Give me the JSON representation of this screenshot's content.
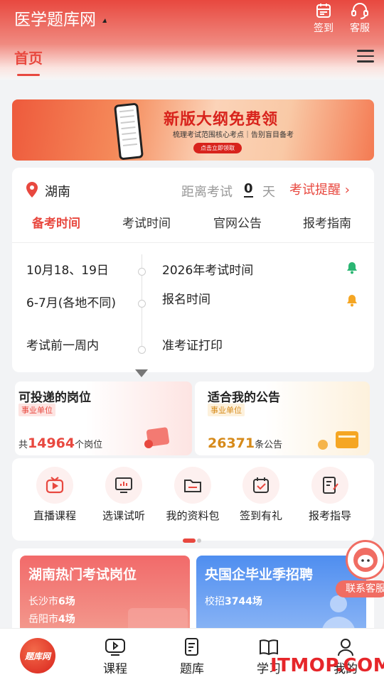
{
  "header": {
    "app_title": "医学题库网",
    "sign_label": "签到",
    "service_label": "客服",
    "home_tab": "首页"
  },
  "banner": {
    "title": "新版大纲免费领",
    "subtitle": "梳理考试范围核心考点｜告别盲目备考",
    "button": "点击立即领取"
  },
  "exam": {
    "location": "湖南",
    "distance_label": "距离考试",
    "distance_days": "0",
    "distance_unit": "天",
    "remind_link": "考试提醒",
    "tabs": [
      {
        "label": "备考时间",
        "active": true
      },
      {
        "label": "考试时间",
        "active": false
      },
      {
        "label": "官网公告",
        "active": false
      },
      {
        "label": "报考指南",
        "active": false
      }
    ],
    "timeline": [
      {
        "date": "10月18、19日",
        "event": "2026年考试时间",
        "bell_color": "#2bb673"
      },
      {
        "date": "6-7月(各地不同)",
        "event": "报名时间",
        "bell_color": "#f5a623"
      },
      {
        "date": "考试前一周内",
        "event": "准考证打印",
        "bell_color": ""
      }
    ]
  },
  "promos": {
    "jobs": {
      "title": "可投递的岗位",
      "tag": "事业单位",
      "prefix": "共",
      "count": "14964",
      "suffix": "个岗位"
    },
    "notices": {
      "title": "适合我的公告",
      "tag": "事业单位",
      "count": "26371",
      "suffix": "条公告"
    }
  },
  "quick": {
    "items": [
      {
        "label": "直播课程",
        "icon": "live-tv-icon"
      },
      {
        "label": "选课试听",
        "icon": "monitor-chart-icon"
      },
      {
        "label": "我的资料包",
        "icon": "folder-icon"
      },
      {
        "label": "签到有礼",
        "icon": "calendar-check-icon"
      },
      {
        "label": "报考指导",
        "icon": "document-edit-icon"
      }
    ]
  },
  "recruit": {
    "hot": {
      "title": "湖南热门考试岗位",
      "line1_city": "长沙市",
      "line1_count": "6场",
      "line2_city": "岳阳市",
      "line2_count": "4场"
    },
    "soe": {
      "title": "央国企毕业季招聘",
      "line1_label": "校招",
      "line1_count": "3744场"
    }
  },
  "float_service": {
    "label": "联系客服"
  },
  "bottom_nav": {
    "logo": "题库网",
    "items": [
      {
        "label": "课程"
      },
      {
        "label": "题库"
      },
      {
        "label": "学习"
      },
      {
        "label": "我的"
      }
    ]
  },
  "watermark": "ITMOP.COM",
  "colors": {
    "brand": "#e8483f",
    "accent_orange": "#d68a1a",
    "blue": "#4f8ef0"
  }
}
